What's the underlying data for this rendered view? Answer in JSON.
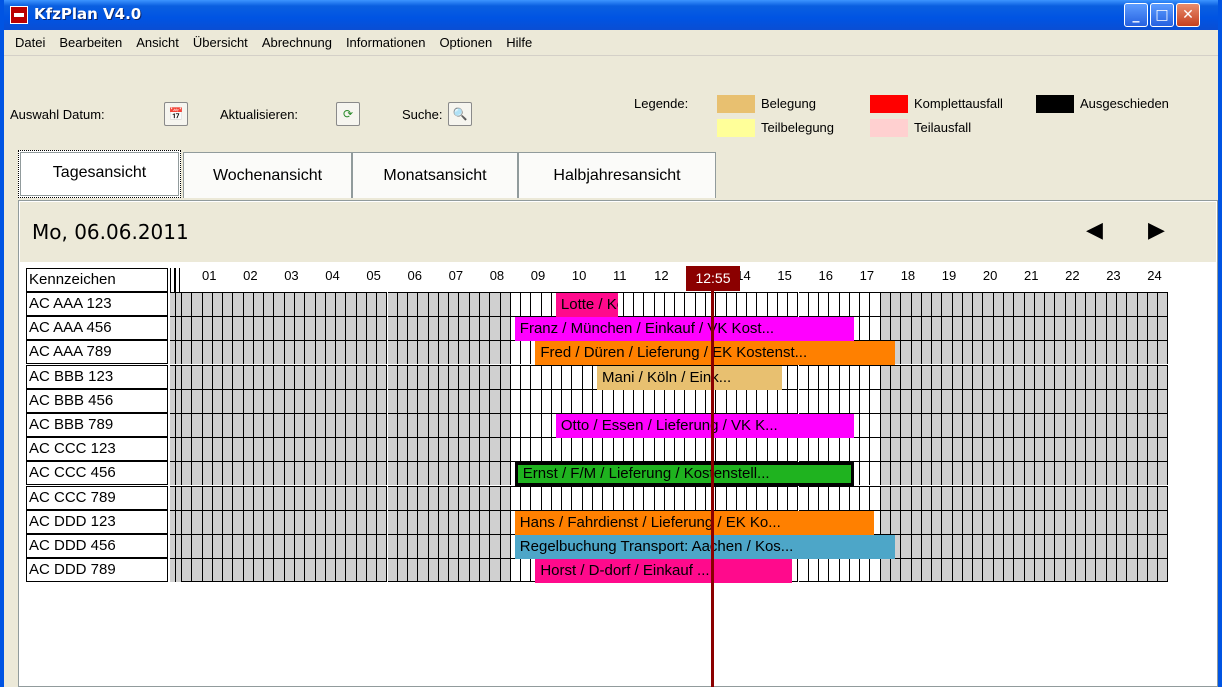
{
  "window": {
    "title": "KfzPlan V4.0"
  },
  "menu": [
    "Datei",
    "Bearbeiten",
    "Ansicht",
    "Übersicht",
    "Abrechnung",
    "Informationen",
    "Optionen",
    "Hilfe"
  ],
  "toolbar": {
    "date_label": "Auswahl Datum:",
    "refresh_label": "Aktualisieren:",
    "search_label": "Suche:"
  },
  "legend": {
    "title": "Legende:",
    "items": [
      {
        "label": "Belegung",
        "color": "#e8c070"
      },
      {
        "label": "Teilbelegung",
        "color": "#ffff99"
      },
      {
        "label": "Komplettausfall",
        "color": "#ff0000"
      },
      {
        "label": "Teilausfall",
        "color": "#ffd0d0"
      },
      {
        "label": "Ausgeschieden",
        "color": "#000000"
      }
    ]
  },
  "tabs": [
    "Tagesansicht",
    "Wochenansicht",
    "Monatsansicht",
    "Halbjahresansicht"
  ],
  "date": "Mo, 06.06.2011",
  "grid": {
    "header": "Kennzeichen",
    "hours": [
      "01",
      "02",
      "03",
      "04",
      "05",
      "06",
      "07",
      "08",
      "09",
      "10",
      "11",
      "12",
      "13",
      "14",
      "15",
      "16",
      "17",
      "18",
      "19",
      "20",
      "21",
      "22",
      "23",
      "24"
    ],
    "current_time": "12:55",
    "rows": [
      "AC AAA 123",
      "AC AAA 456",
      "AC AAA 789",
      "AC BBB 123",
      "AC BBB 456",
      "AC BBB 789",
      "AC CCC 123",
      "AC CCC 456",
      "AC CCC 789",
      "AC DDD 123",
      "AC DDD 456",
      "AC DDD 789"
    ]
  },
  "bookings": [
    {
      "row": 0,
      "start": 9.0,
      "end": 10.5,
      "text": "Lotte / Köln / Ein...",
      "color": "#ff0a8c"
    },
    {
      "row": 1,
      "start": 8.0,
      "end": 16.25,
      "text": "Franz / München / Einkauf / VK Kost...",
      "color": "#ff00ff"
    },
    {
      "row": 2,
      "start": 8.5,
      "end": 17.25,
      "text": "Fred / Düren / Lieferung / EK Kostenst...",
      "color": "#ff8000"
    },
    {
      "row": 3,
      "start": 10.0,
      "end": 14.5,
      "text": "Mani / Köln / Eink...",
      "color": "#e8c070"
    },
    {
      "row": 5,
      "start": 9.0,
      "end": 16.25,
      "text": "Otto / Essen / Lieferung / VK K...",
      "color": "#ff00ff"
    },
    {
      "row": 7,
      "start": 8.0,
      "end": 16.25,
      "text": "Ernst / F/M / Lieferung / Kostenstell...",
      "color": "#1fb31f",
      "selected": true
    },
    {
      "row": 9,
      "start": 8.0,
      "end": 16.75,
      "text": "Hans / Fahrdienst / Lieferung / EK Ko...",
      "color": "#ff8000"
    },
    {
      "row": 10,
      "start": 8.0,
      "end": 17.25,
      "text": "Regelbuchung Transport: Aachen / Kos...",
      "color": "#4da6c8"
    },
    {
      "row": 11,
      "start": 8.5,
      "end": 14.75,
      "text": "Horst / D-dorf / Einkauf ...",
      "color": "#ff0a8c"
    }
  ]
}
